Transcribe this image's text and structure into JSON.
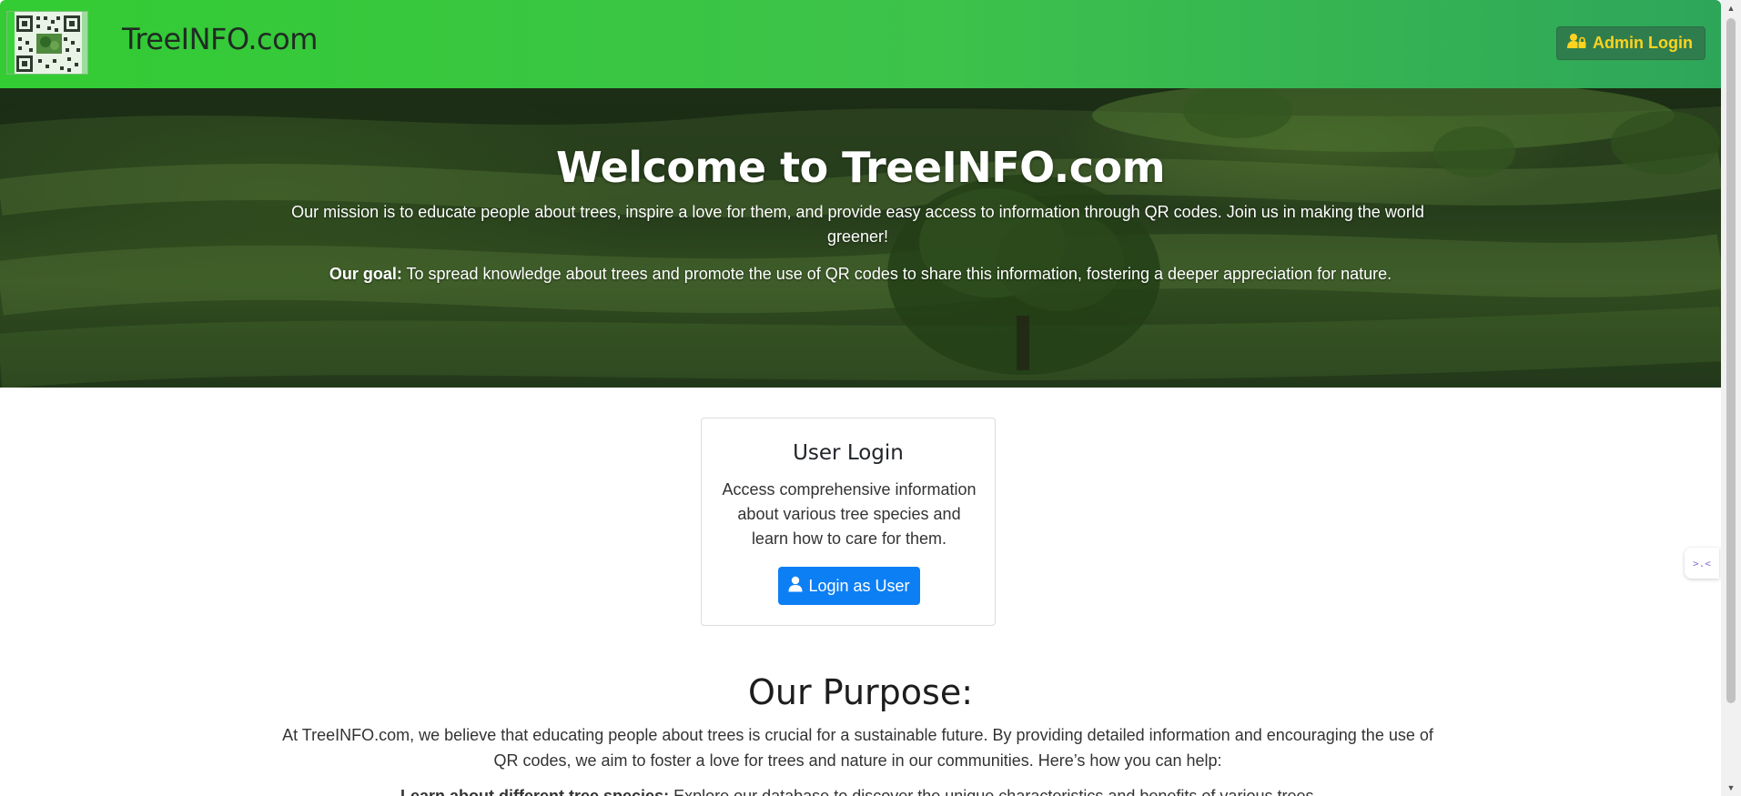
{
  "navbar": {
    "brand": "TreeINFO.com",
    "admin_login_label": "Admin Login",
    "admin_icon": "user-lock-icon",
    "logo_icon": "qr-code-icon"
  },
  "hero": {
    "title": "Welcome to TreeINFO.com",
    "mission": "Our mission is to educate people about trees, inspire a love for them, and provide easy access to information through QR codes. Join us in making the world greener!",
    "goal_label": "Our goal:",
    "goal_text": " To spread knowledge about trees and promote the use of QR codes to share this information, fostering a deeper appreciation for nature."
  },
  "user_card": {
    "title": "User Login",
    "description": "Access comprehensive information about various tree species and learn how to care for them.",
    "button_label": "Login as User",
    "button_icon": "user-icon"
  },
  "purpose": {
    "title": "Our Purpose:",
    "text": "At TreeINFO.com, we believe that educating people about trees is crucial for a sustainable future. By providing detailed information and encouraging the use of QR codes, we aim to foster a love for trees and nature in our communities. Here’s how you can help:",
    "first_item_bold": "Learn about different tree species:",
    "first_item_text": " Explore our database to discover the unique characteristics and benefits of various trees."
  },
  "colors": {
    "navbar_start": "#33cc33",
    "navbar_end": "#2ea65a",
    "admin_text": "#ffd21f",
    "primary_button": "#0d7ff5"
  }
}
